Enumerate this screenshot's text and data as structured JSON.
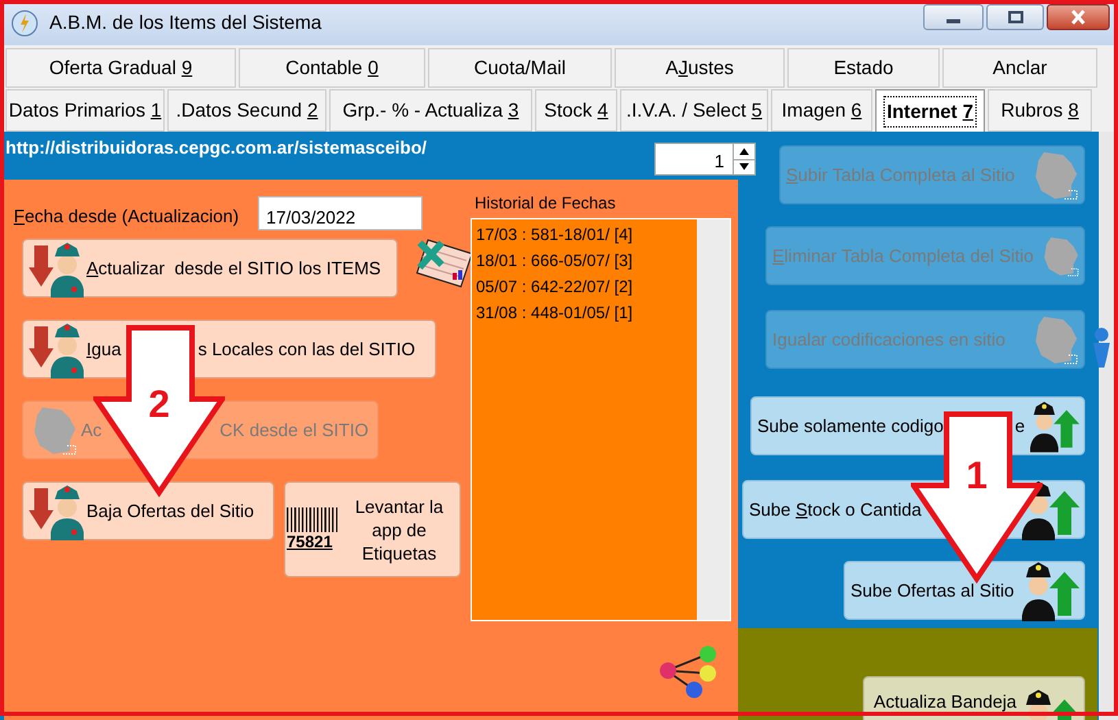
{
  "window": {
    "title": "A.B.M. de los Items del Sistema"
  },
  "tabs_row_1": [
    {
      "label": [
        {
          "text": "Oferta Gradual "
        },
        {
          "text": "9",
          "underline": true
        }
      ],
      "selected": false
    },
    {
      "label": [
        {
          "text": "Contable "
        },
        {
          "text": "0",
          "underline": true
        }
      ],
      "selected": false
    },
    {
      "label": [
        {
          "text": "Cuota/Mail"
        }
      ],
      "selected": false
    },
    {
      "label": [
        {
          "text": "A"
        },
        {
          "text": "J",
          "underline": true
        },
        {
          "text": "ustes"
        }
      ],
      "selected": false
    },
    {
      "label": [
        {
          "text": "Estado"
        }
      ],
      "selected": false
    },
    {
      "label": [
        {
          "text": "Anclar"
        }
      ],
      "selected": false
    }
  ],
  "tabs_row_2": [
    {
      "label": [
        {
          "text": "Datos Primarios "
        },
        {
          "text": "1",
          "underline": true
        }
      ],
      "selected": false
    },
    {
      "label": [
        {
          "text": ".Datos Secund "
        },
        {
          "text": "2",
          "underline": true
        }
      ],
      "selected": false
    },
    {
      "label": [
        {
          "text": "Grp.- % - Actualiza "
        },
        {
          "text": "3",
          "underline": true
        }
      ],
      "selected": false
    },
    {
      "label": [
        {
          "text": "Stock "
        },
        {
          "text": "4",
          "underline": true
        }
      ],
      "selected": false
    },
    {
      "label": [
        {
          "text": ".I.V.A. / Select "
        },
        {
          "text": "5",
          "underline": true
        }
      ],
      "selected": false
    },
    {
      "label": [
        {
          "text": "Imagen "
        },
        {
          "text": "6",
          "underline": true
        }
      ],
      "selected": false
    },
    {
      "label": [
        {
          "text": "Internet "
        },
        {
          "text": "7",
          "underline": true
        }
      ],
      "selected": true
    },
    {
      "label": [
        {
          "text": "Rubros "
        },
        {
          "text": "8",
          "underline": true
        }
      ],
      "selected": false
    }
  ],
  "site_url": "http://distribuidoras.cepgc.com.ar/sistemasceibo/",
  "spinner": {
    "value": "1"
  },
  "date_from": {
    "label": [
      {
        "text": "F",
        "underline": true
      },
      {
        "text": "echa desde (Actualizacion)"
      }
    ],
    "value": "17/03/2022"
  },
  "history": {
    "title": "Historial de Fechas",
    "items": [
      "17/03 : 581-18/01/ [4]",
      "18/01 : 666-05/07/ [3]",
      "05/07 : 642-22/07/ [2]",
      "31/08 : 448-01/05/ [1]"
    ]
  },
  "left_buttons": [
    {
      "kind": "download",
      "disabled": false,
      "runs": [
        [
          {
            "text": "A",
            "underline": true
          },
          {
            "text": "ctualizar  desde el SITIO los ITEMS"
          }
        ]
      ]
    },
    {
      "kind": "download",
      "disabled": false,
      "runs": [
        [
          {
            "text": "I",
            "underline": true
          },
          {
            "text": "gua"
          }
        ],
        [
          {
            "text": "s Locales con las del SITIO"
          }
        ]
      ]
    },
    {
      "kind": "download",
      "disabled": true,
      "runs": [
        [
          {
            "text": "Ac"
          }
        ],
        [
          {
            "text": "CK desde el SITIO"
          }
        ]
      ]
    },
    {
      "kind": "download",
      "disabled": false,
      "runs": [
        [
          {
            "text": "Baja Ofertas del Sitio"
          }
        ]
      ]
    }
  ],
  "labels_button": {
    "barcode_number": "75821",
    "label": "Levantar la app de Etiquetas"
  },
  "right_buttons": [
    {
      "kind": "upload",
      "disabled": true,
      "runs": [
        [
          {
            "text": "S",
            "underline": true
          },
          {
            "text": "ubir Tabla Completa al Sitio"
          }
        ]
      ]
    },
    {
      "kind": "upload",
      "disabled": true,
      "runs": [
        [
          {
            "text": "E",
            "underline": true
          },
          {
            "text": "liminar Tabla Completa del Sitio"
          }
        ]
      ]
    },
    {
      "kind": "upload",
      "disabled": true,
      "runs": [
        [
          {
            "text": "Igualar codificaciones en sitio"
          }
        ]
      ]
    },
    {
      "kind": "upload",
      "disabled": false,
      "runs": [
        [
          {
            "text": "Sube solamente codigo"
          }
        ],
        [
          {
            "text": "e"
          }
        ]
      ]
    },
    {
      "kind": "upload",
      "disabled": false,
      "runs": [
        [
          {
            "text": "Sube "
          },
          {
            "text": "S",
            "underline": true
          },
          {
            "text": "tock o Cantida"
          }
        ]
      ]
    },
    {
      "kind": "upload",
      "disabled": false,
      "runs": [
        [
          {
            "text": "Sube Ofertas al Sitio"
          }
        ]
      ]
    }
  ],
  "tray_button": {
    "kind": "upload",
    "disabled": false,
    "runs": [
      [
        {
          "text": "Actualiza Bandeja"
        }
      ]
    ]
  },
  "annotations": [
    {
      "label": "2"
    },
    {
      "label": "1"
    }
  ]
}
